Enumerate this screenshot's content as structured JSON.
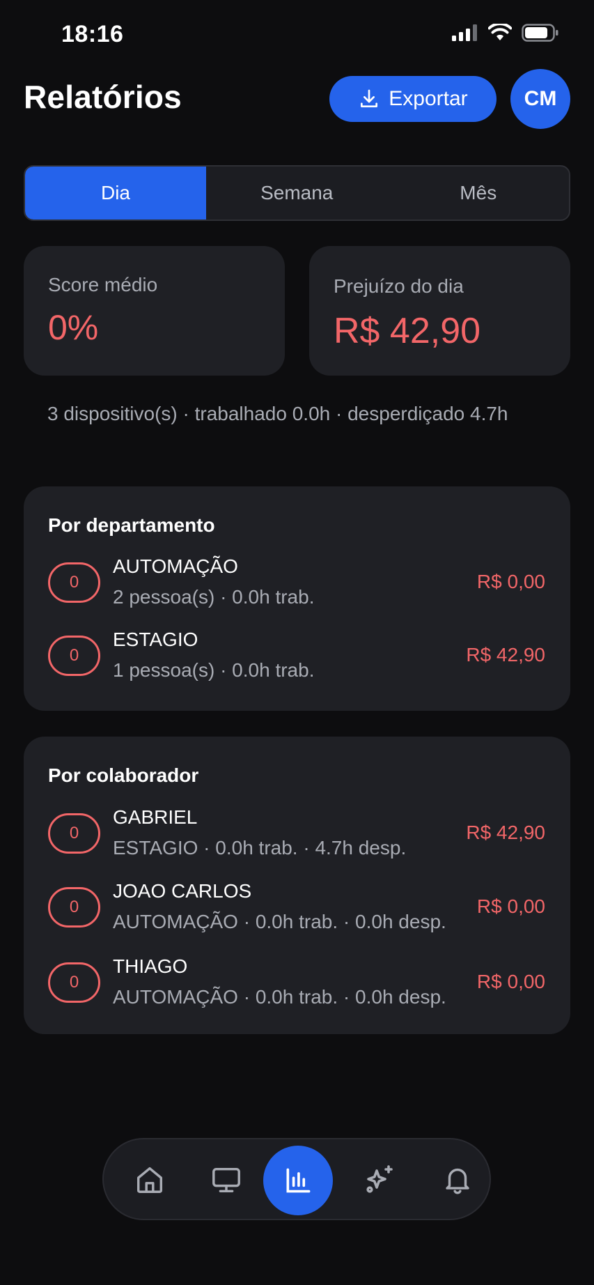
{
  "status_bar": {
    "time": "18:16"
  },
  "header": {
    "title": "Relatórios",
    "export_label": "Exportar",
    "avatar_initials": "CM"
  },
  "tabs": [
    {
      "label": "Dia",
      "active": true
    },
    {
      "label": "Semana",
      "active": false
    },
    {
      "label": "Mês",
      "active": false
    }
  ],
  "stats": {
    "score": {
      "label": "Score médio",
      "value": "0%"
    },
    "loss": {
      "label": "Prejuízo do dia",
      "value": "R$ 42,90"
    }
  },
  "summary": "3 dispositivo(s) · trabalhado 0.0h · desperdiçado 4.7h",
  "by_department": {
    "title": "Por departamento",
    "rows": [
      {
        "score": "0",
        "name": "AUTOMAÇÃO",
        "sub": "2 pessoa(s) · 0.0h trab.",
        "amount": "R$ 0,00"
      },
      {
        "score": "0",
        "name": "ESTAGIO",
        "sub": "1 pessoa(s) · 0.0h trab.",
        "amount": "R$ 42,90"
      }
    ]
  },
  "by_collaborator": {
    "title": "Por colaborador",
    "rows": [
      {
        "score": "0",
        "name": "GABRIEL",
        "sub": "ESTAGIO · 0.0h trab. · 4.7h desp.",
        "amount": "R$ 42,90"
      },
      {
        "score": "0",
        "name": "JOAO CARLOS",
        "sub": "AUTOMAÇÃO · 0.0h trab. · 0.0h desp.",
        "amount": "R$ 0,00"
      },
      {
        "score": "0",
        "name": "THIAGO",
        "sub": "AUTOMAÇÃO · 0.0h trab. · 0.0h desp.",
        "amount": "R$ 0,00"
      }
    ]
  },
  "bottom_nav": [
    {
      "icon": "home-icon",
      "active": false
    },
    {
      "icon": "monitor-icon",
      "active": false
    },
    {
      "icon": "bar-chart-icon",
      "active": true
    },
    {
      "icon": "sparkles-icon",
      "active": false
    },
    {
      "icon": "bell-icon",
      "active": false
    }
  ],
  "colors": {
    "accent": "#2563eb",
    "danger": "#f26668",
    "background": "#0d0d0f",
    "card": "#1f2025"
  }
}
